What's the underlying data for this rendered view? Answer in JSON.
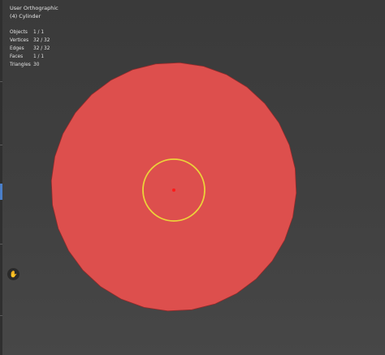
{
  "viewport": {
    "view_name": "User Orthographic",
    "object_label": "(4) Cylinder"
  },
  "stats": [
    {
      "label": "Objects",
      "value": "1 / 1"
    },
    {
      "label": "Vertices",
      "value": "32 / 32"
    },
    {
      "label": "Edges",
      "value": "32 / 32"
    },
    {
      "label": "Faces",
      "value": "1 / 1"
    },
    {
      "label": "Triangles",
      "value": "30"
    }
  ],
  "mesh": {
    "sides": 32,
    "fill_color": "#dd4f4d",
    "edge_color": "#8f2b2b"
  },
  "gizmo": {
    "ring_color": "#ecd33a",
    "origin_color": "#ff1a1a",
    "nav_icon": "hand-grab-icon"
  },
  "theme": {
    "active_tab_color": "#4a7fc9"
  }
}
